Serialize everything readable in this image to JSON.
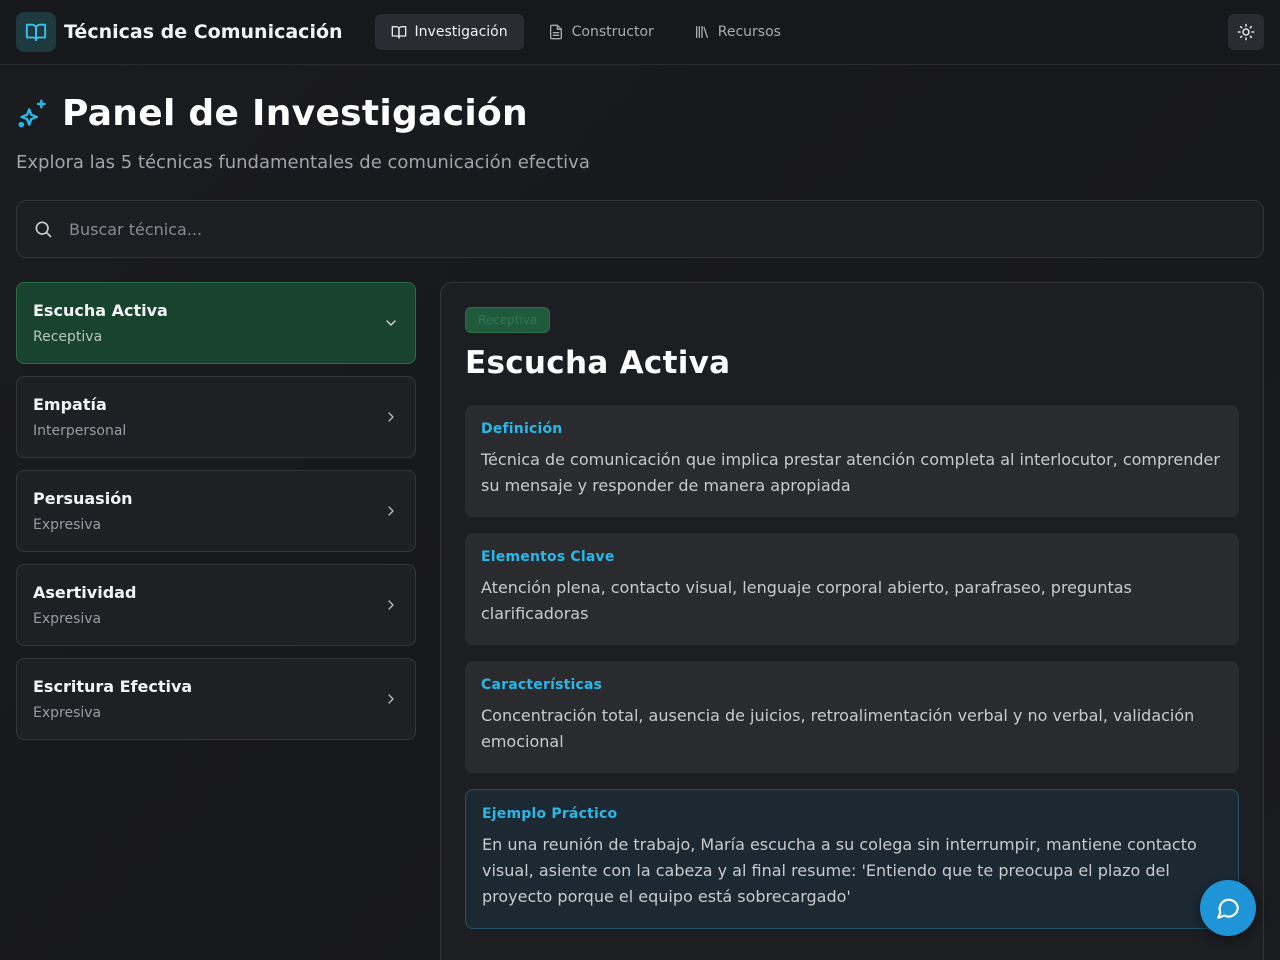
{
  "brand": {
    "title": "Técnicas de Comunicación"
  },
  "nav": [
    {
      "label": "Investigación",
      "icon": "book-open-icon",
      "active": true
    },
    {
      "label": "Constructor",
      "icon": "file-text-icon",
      "active": false
    },
    {
      "label": "Recursos",
      "icon": "library-icon",
      "active": false
    }
  ],
  "header": {
    "title": "Panel de Investigación",
    "subtitle": "Explora las 5 técnicas fundamentales de comunicación efectiva"
  },
  "search": {
    "placeholder": "Buscar técnica...",
    "value": ""
  },
  "techniques": [
    {
      "title": "Escucha Activa",
      "category": "Receptiva",
      "selected": true
    },
    {
      "title": "Empatía",
      "category": "Interpersonal",
      "selected": false
    },
    {
      "title": "Persuasión",
      "category": "Expresiva",
      "selected": false
    },
    {
      "title": "Asertividad",
      "category": "Expresiva",
      "selected": false
    },
    {
      "title": "Escritura Efectiva",
      "category": "Expresiva",
      "selected": false
    }
  ],
  "detail": {
    "badge": "Receptiva",
    "title": "Escucha Activa",
    "sections": [
      {
        "label": "Definición",
        "text": "Técnica de comunicación que implica prestar atención completa al interlocutor, comprender su mensaje y responder de manera apropiada"
      },
      {
        "label": "Elementos Clave",
        "text": "Atención plena, contacto visual, lenguaje corporal abierto, parafraseo, preguntas clarificadoras"
      },
      {
        "label": "Características",
        "text": "Concentración total, ausencia de juicios, retroalimentación verbal y no verbal, validación emocional"
      },
      {
        "label": "Ejemplo Práctico",
        "text": "En una reunión de trabajo, María escucha a su colega sin interrumpir, mantiene contacto visual, asiente con la cabeza y al final resume: 'Entiendo que te preocupa el plazo del proyecto porque el equipo está sobrecargado'"
      }
    ]
  },
  "colors": {
    "accent": "#2ab8e8",
    "selected_bg": "#17432f",
    "fab": "#1f94d6"
  }
}
